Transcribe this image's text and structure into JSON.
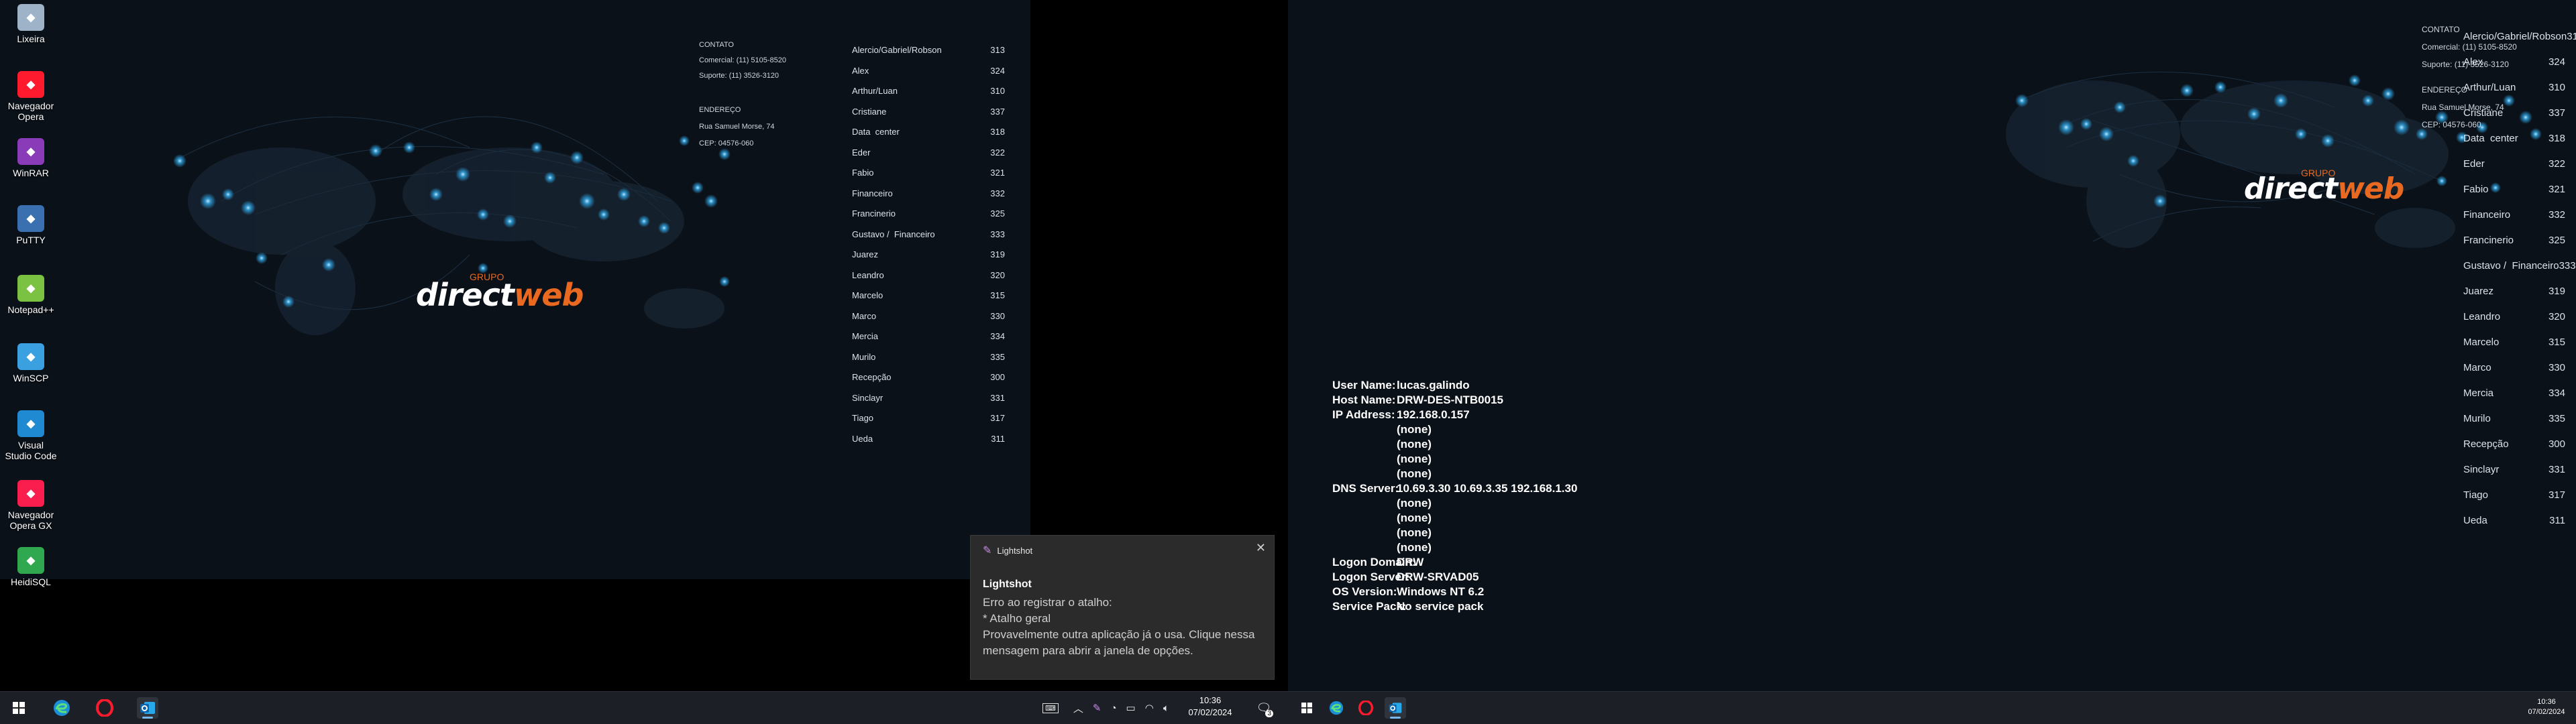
{
  "desktop_icons": [
    {
      "label": "Lixeira",
      "icon": "recycle-bin-icon",
      "color": "#9fb3c8"
    },
    {
      "label": "Navegador Opera",
      "icon": "opera-icon",
      "color": "#ff1b2d"
    },
    {
      "label": "WinRAR",
      "icon": "winrar-icon",
      "color": "#8a3bb8"
    },
    {
      "label": "PuTTY",
      "icon": "putty-icon",
      "color": "#3a6fb0"
    },
    {
      "label": "Notepad++",
      "icon": "notepadpp-icon",
      "color": "#7cc242"
    },
    {
      "label": "WinSCP",
      "icon": "winscp-icon",
      "color": "#3aa0e0"
    },
    {
      "label": "Visual Studio Code",
      "icon": "vscode-icon",
      "color": "#1f8ad2"
    },
    {
      "label": "Navegador Opera GX",
      "icon": "opera-gx-icon",
      "color": "#fa1e4e"
    },
    {
      "label": "HeidiSQL",
      "icon": "heidisql-icon",
      "color": "#2fa84f"
    }
  ],
  "wallpaper": {
    "logo": {
      "grupo": "GRUPO",
      "direct": "direct",
      "web": "web"
    },
    "contact": {
      "heading": "CONTATO",
      "comercial": "Comercial: (11) 5105-8520",
      "suporte": "Suporte: (11) 3526-3120",
      "address_heading": "ENDEREÇO",
      "street": "Rua Samuel Morse, 74",
      "cep": "CEP: 04576-060"
    },
    "extensions": [
      {
        "name": "Alercio/Gabriel/Robson",
        "ext": "313"
      },
      {
        "name": "Alex",
        "ext": "324"
      },
      {
        "name": "Arthur/Luan",
        "ext": "310"
      },
      {
        "name": "Cristiane",
        "ext": "337"
      },
      {
        "name": "Data  center",
        "ext": "318"
      },
      {
        "name": "Eder",
        "ext": "322"
      },
      {
        "name": "Fabio",
        "ext": "321"
      },
      {
        "name": "Financeiro",
        "ext": "332"
      },
      {
        "name": "Francinerio",
        "ext": "325"
      },
      {
        "name": "Gustavo /  Financeiro",
        "ext": "333"
      },
      {
        "name": "Juarez",
        "ext": "319"
      },
      {
        "name": "Leandro",
        "ext": "320"
      },
      {
        "name": "Marcelo",
        "ext": "315"
      },
      {
        "name": "Marco",
        "ext": "330"
      },
      {
        "name": "Mercia",
        "ext": "334"
      },
      {
        "name": "Murilo",
        "ext": "335"
      },
      {
        "name": "Recepção",
        "ext": "300"
      },
      {
        "name": "Sinclayr",
        "ext": "331"
      },
      {
        "name": "Tiago",
        "ext": "317"
      },
      {
        "name": "Ueda",
        "ext": "311"
      }
    ]
  },
  "bginfo": [
    {
      "key": "User Name:",
      "value": "lucas.galindo"
    },
    {
      "key": "Host Name:",
      "value": "DRW-DES-NTB0015"
    },
    {
      "key": "IP Address:",
      "value": "192.168.0.157"
    },
    {
      "key": "",
      "value": "(none)"
    },
    {
      "key": "",
      "value": "(none)"
    },
    {
      "key": "",
      "value": "(none)"
    },
    {
      "key": "",
      "value": "(none)"
    },
    {
      "key": "DNS Server:",
      "value": "10.69.3.30 10.69.3.35 192.168.1.30"
    },
    {
      "key": "",
      "value": "(none)"
    },
    {
      "key": "",
      "value": "(none)"
    },
    {
      "key": "",
      "value": "(none)"
    },
    {
      "key": "",
      "value": "(none)"
    },
    {
      "key": "Logon Domain:",
      "value": "DRW"
    },
    {
      "key": "Logon Server:",
      "value": "DRW-SRVAD05"
    },
    {
      "key": "OS Version:",
      "value": "Windows NT 6.2"
    },
    {
      "key": "Service Pack:",
      "value": "No service pack"
    }
  ],
  "toast": {
    "app": "Lightshot",
    "title": "Lightshot",
    "line1": "Erro ao registrar o atalho:",
    "line2": "* Atalho geral",
    "line3": "Provavelmente outra aplicação já o usa. Clique nessa mensagem para abrir a janela de opções."
  },
  "taskbar_left": {
    "apps": [
      "windows-start-icon",
      "edge-icon",
      "opera-icon",
      "outlook-icon"
    ],
    "clock": {
      "time": "10:36",
      "date": "07/02/2024"
    },
    "notification_count": "3"
  },
  "taskbar_right": {
    "apps": [
      "windows-start-icon",
      "edge-icon",
      "opera-icon",
      "outlook-icon"
    ],
    "clock": {
      "time": "10:36",
      "date": "07/02/2024"
    }
  },
  "colors": {
    "accent": "#e8691f",
    "glow": "#2fa8e8",
    "taskbar": "#1c1f25"
  }
}
